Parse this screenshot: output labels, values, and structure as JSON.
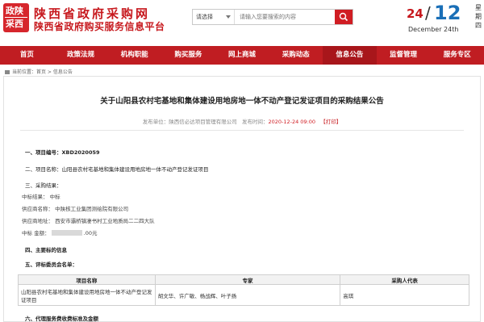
{
  "header": {
    "logo_line1": "政陕",
    "logo_line2": "采西",
    "title": "陕西省政府采购网",
    "subtitle": "陕西省政府购买服务信息平台"
  },
  "search": {
    "select_value": "请选择",
    "placeholder": "请输入您要搜索的内容"
  },
  "date": {
    "month": "24",
    "day": "12",
    "weekday_1": "星",
    "weekday_2": "期",
    "weekday_3": "四",
    "english": "December  24th"
  },
  "nav": {
    "items": [
      "首页",
      "政策法规",
      "机构职能",
      "购买服务",
      "网上商城",
      "采购动态",
      "信息公告",
      "监督管理",
      "服务专区"
    ],
    "active_index": 6
  },
  "breadcrumb": {
    "text": "当前位置：首页 > 信息公告"
  },
  "article": {
    "title": "关于山阳县农村宅基地和集体建设用地房地一体不动产登记发证项目的采购结果公告",
    "publisher_label": "发布单位：",
    "publisher": "陕西信必达项目管理有限公司",
    "time_label": "发布时间：",
    "time": "2020-12-24 09:00",
    "print": "【打印】",
    "item1": "一、项目编号：XBD2020059",
    "item2": "二、项目名称：山阳县农村宅基地和集体建设用地房地一体不动产登记发证项目",
    "item3": "三、采购结果：",
    "result_label": "中标结果：",
    "result_value": "中标",
    "supplier_label": "供应商名称：",
    "supplier": "中陕核工业集团测绘院有限公司",
    "address_label": "供应商地址：",
    "address": "西安市灞桥镇凄书村工业地质局二二四大队",
    "amount_label": "中标 金额：",
    "amount_suffix": ".00元",
    "item4": "四、主要标的信息",
    "item5": "五、评标委员会名单：",
    "item6": "六、代理服务费收费标准及金额"
  },
  "committee_table": {
    "headers": [
      "项目名称",
      "专家",
      "采购人代表"
    ],
    "rows": [
      [
        "山阳县农村宅基地和集体建设用地房地一体不动产登记发证项目",
        "胡文华、许广敏、杨战辉、叶子扬",
        "高琪"
      ]
    ]
  }
}
